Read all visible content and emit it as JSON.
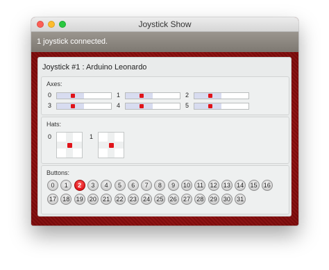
{
  "window": {
    "title": "Joystick Show"
  },
  "status": {
    "text": "1 joystick connected."
  },
  "joystick": {
    "title": "Joystick #1 : Arduino Leonardo",
    "axes_label": "Axes:",
    "axes": [
      {
        "index": "0",
        "value": 0.5
      },
      {
        "index": "1",
        "value": 0.5
      },
      {
        "index": "2",
        "value": 0.5
      },
      {
        "index": "3",
        "value": 0.5
      },
      {
        "index": "4",
        "value": 0.5
      },
      {
        "index": "5",
        "value": 0.5
      }
    ],
    "hats_label": "Hats:",
    "hats": [
      {
        "index": "0",
        "direction": "center"
      },
      {
        "index": "1",
        "direction": "center"
      }
    ],
    "buttons_label": "Buttons:",
    "buttons": [
      "0",
      "1",
      "2",
      "3",
      "4",
      "5",
      "6",
      "7",
      "8",
      "9",
      "10",
      "11",
      "12",
      "13",
      "14",
      "15",
      "16",
      "17",
      "18",
      "19",
      "20",
      "21",
      "22",
      "23",
      "24",
      "25",
      "26",
      "27",
      "28",
      "29",
      "30",
      "31"
    ],
    "pressed_buttons": [
      "2"
    ]
  },
  "colors": {
    "active": "#e0141a",
    "felt": "#8a0d0d",
    "statusbar": "#8c8780"
  }
}
